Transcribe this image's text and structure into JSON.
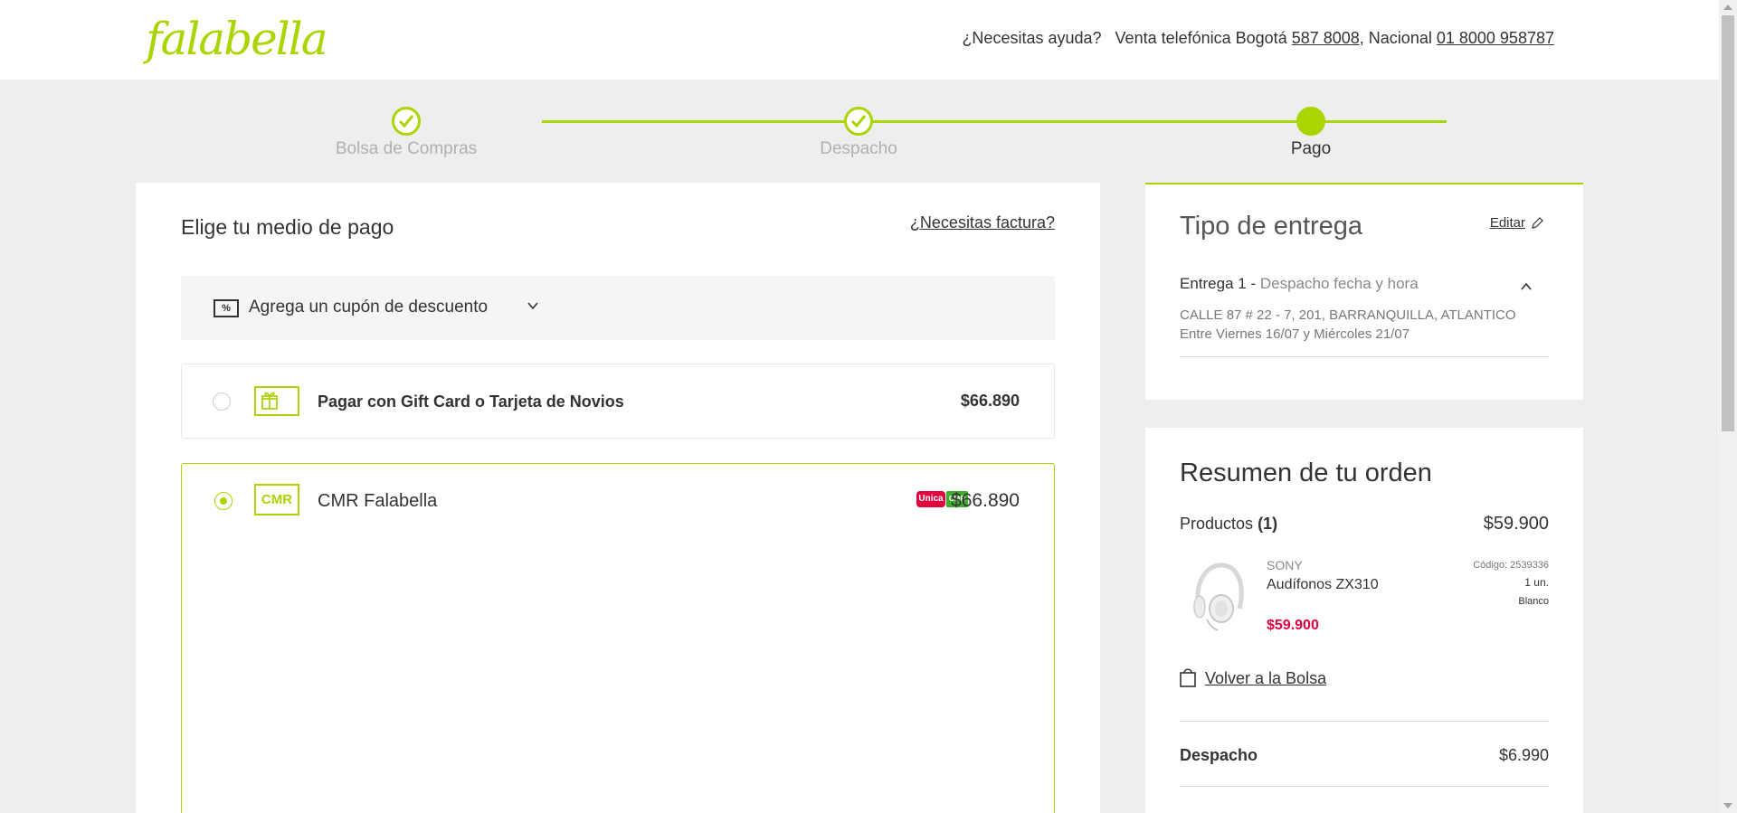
{
  "header": {
    "logo": "falabella",
    "help_text": "¿Necesitas ayuda?",
    "phone_prefix": "Venta telefónica Bogotá",
    "phone_bogota": "587 8008",
    "national_prefix": ", Nacional",
    "phone_national": "01 8000 958787"
  },
  "steps": [
    {
      "label": "Bolsa de Compras",
      "state": "done"
    },
    {
      "label": "Despacho",
      "state": "done"
    },
    {
      "label": "Pago",
      "state": "active"
    }
  ],
  "payment": {
    "title": "Elige tu medio de pago",
    "invoice_link": "¿Necesitas factura?",
    "coupon_icon": "%",
    "coupon_label": "Agrega un cupón de descuento",
    "options": [
      {
        "label": "Pagar con Gift Card o Tarjeta de Novios",
        "price": "$66.890",
        "icon": "gift-icon",
        "selected": false
      },
      {
        "label": "CMR Falabella",
        "price": "$66.890",
        "icon_text": "CMR",
        "selected": true,
        "badge_unica": "Unica",
        "badge_cmr": "CMR"
      }
    ]
  },
  "delivery": {
    "title": "Tipo de entrega",
    "edit_label": "Editar",
    "entrega_label": "Entrega 1 -",
    "entrega_type": "Despacho fecha y hora",
    "address": "CALLE 87 # 22 - 7, 201, BARRANQUILLA, ATLANTICO",
    "window": "Entre Viernes 16/07 y Miércoles 21/07"
  },
  "summary": {
    "title": "Resumen de tu orden",
    "products_label": "Productos",
    "products_count": "(1)",
    "products_total": "$59.900",
    "product": {
      "brand": "SONY",
      "name": "Audífonos ZX310",
      "price": "$59.900",
      "code": "Código: 2539336",
      "qty": "1 un.",
      "color": "Blanco"
    },
    "back_link": "Volver a la Bolsa",
    "shipping_label": "Despacho",
    "shipping_price": "$6.990"
  },
  "colors": {
    "accent": "#aad500",
    "price_red": "#e3003f"
  }
}
